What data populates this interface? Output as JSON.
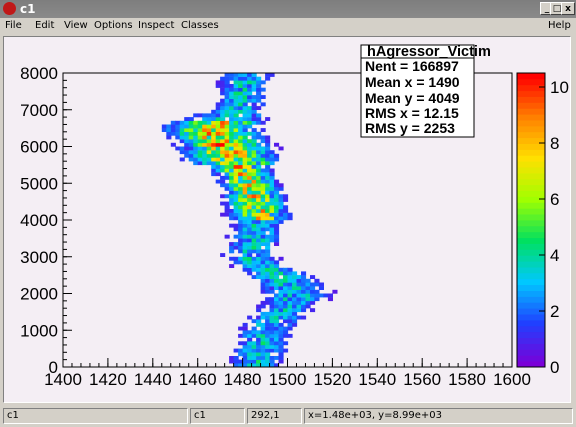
{
  "window": {
    "title": "c1",
    "min_label": "_",
    "max_label": "□",
    "close_label": "x"
  },
  "menu": {
    "file": "File",
    "edit": "Edit",
    "view": "View",
    "options": "Options",
    "inspect": "Inspect",
    "classes": "Classes",
    "help": "Help"
  },
  "statsbox": {
    "name": "hAgressor_Victim",
    "nent": "Nent = 166897",
    "mean_x": "Mean x =   1490",
    "mean_y": "Mean y =   4049",
    "rms_x": "RMS x  =  12.15",
    "rms_y": "RMS y  =   2253"
  },
  "chart_data": {
    "type": "heatmap",
    "title": "",
    "x_ticks": [
      "1400",
      "1420",
      "1440",
      "1460",
      "1480",
      "1500",
      "1520",
      "1540",
      "1560",
      "1580",
      "1600"
    ],
    "y_ticks": [
      "0",
      "1000",
      "2000",
      "3000",
      "4000",
      "5000",
      "6000",
      "7000",
      "8000"
    ],
    "xlim": [
      1400,
      1600
    ],
    "ylim": [
      0,
      8000
    ],
    "z_ticks": [
      "0",
      "2",
      "4",
      "6",
      "8",
      "10"
    ],
    "zlim": [
      0,
      10.5
    ],
    "ridge": [
      [
        0,
        1486
      ],
      [
        1000,
        1490
      ],
      [
        2000,
        1505
      ],
      [
        2300,
        1500
      ],
      [
        3000,
        1483
      ],
      [
        4000,
        1488
      ],
      [
        5000,
        1483
      ],
      [
        6000,
        1472
      ],
      [
        6500,
        1465
      ],
      [
        7000,
        1478
      ],
      [
        8000,
        1482
      ]
    ],
    "colors": {
      "palette": [
        "#7a00d8",
        "#2040ff",
        "#00c8ff",
        "#00e060",
        "#a0ff00",
        "#ffe000",
        "#ff8000",
        "#ff0000"
      ],
      "background": "#f4eef4"
    }
  },
  "status": {
    "field1": "c1",
    "field2": "c1",
    "field3": "292,1",
    "field4": "x=1.48e+03, y=8.99e+03"
  }
}
